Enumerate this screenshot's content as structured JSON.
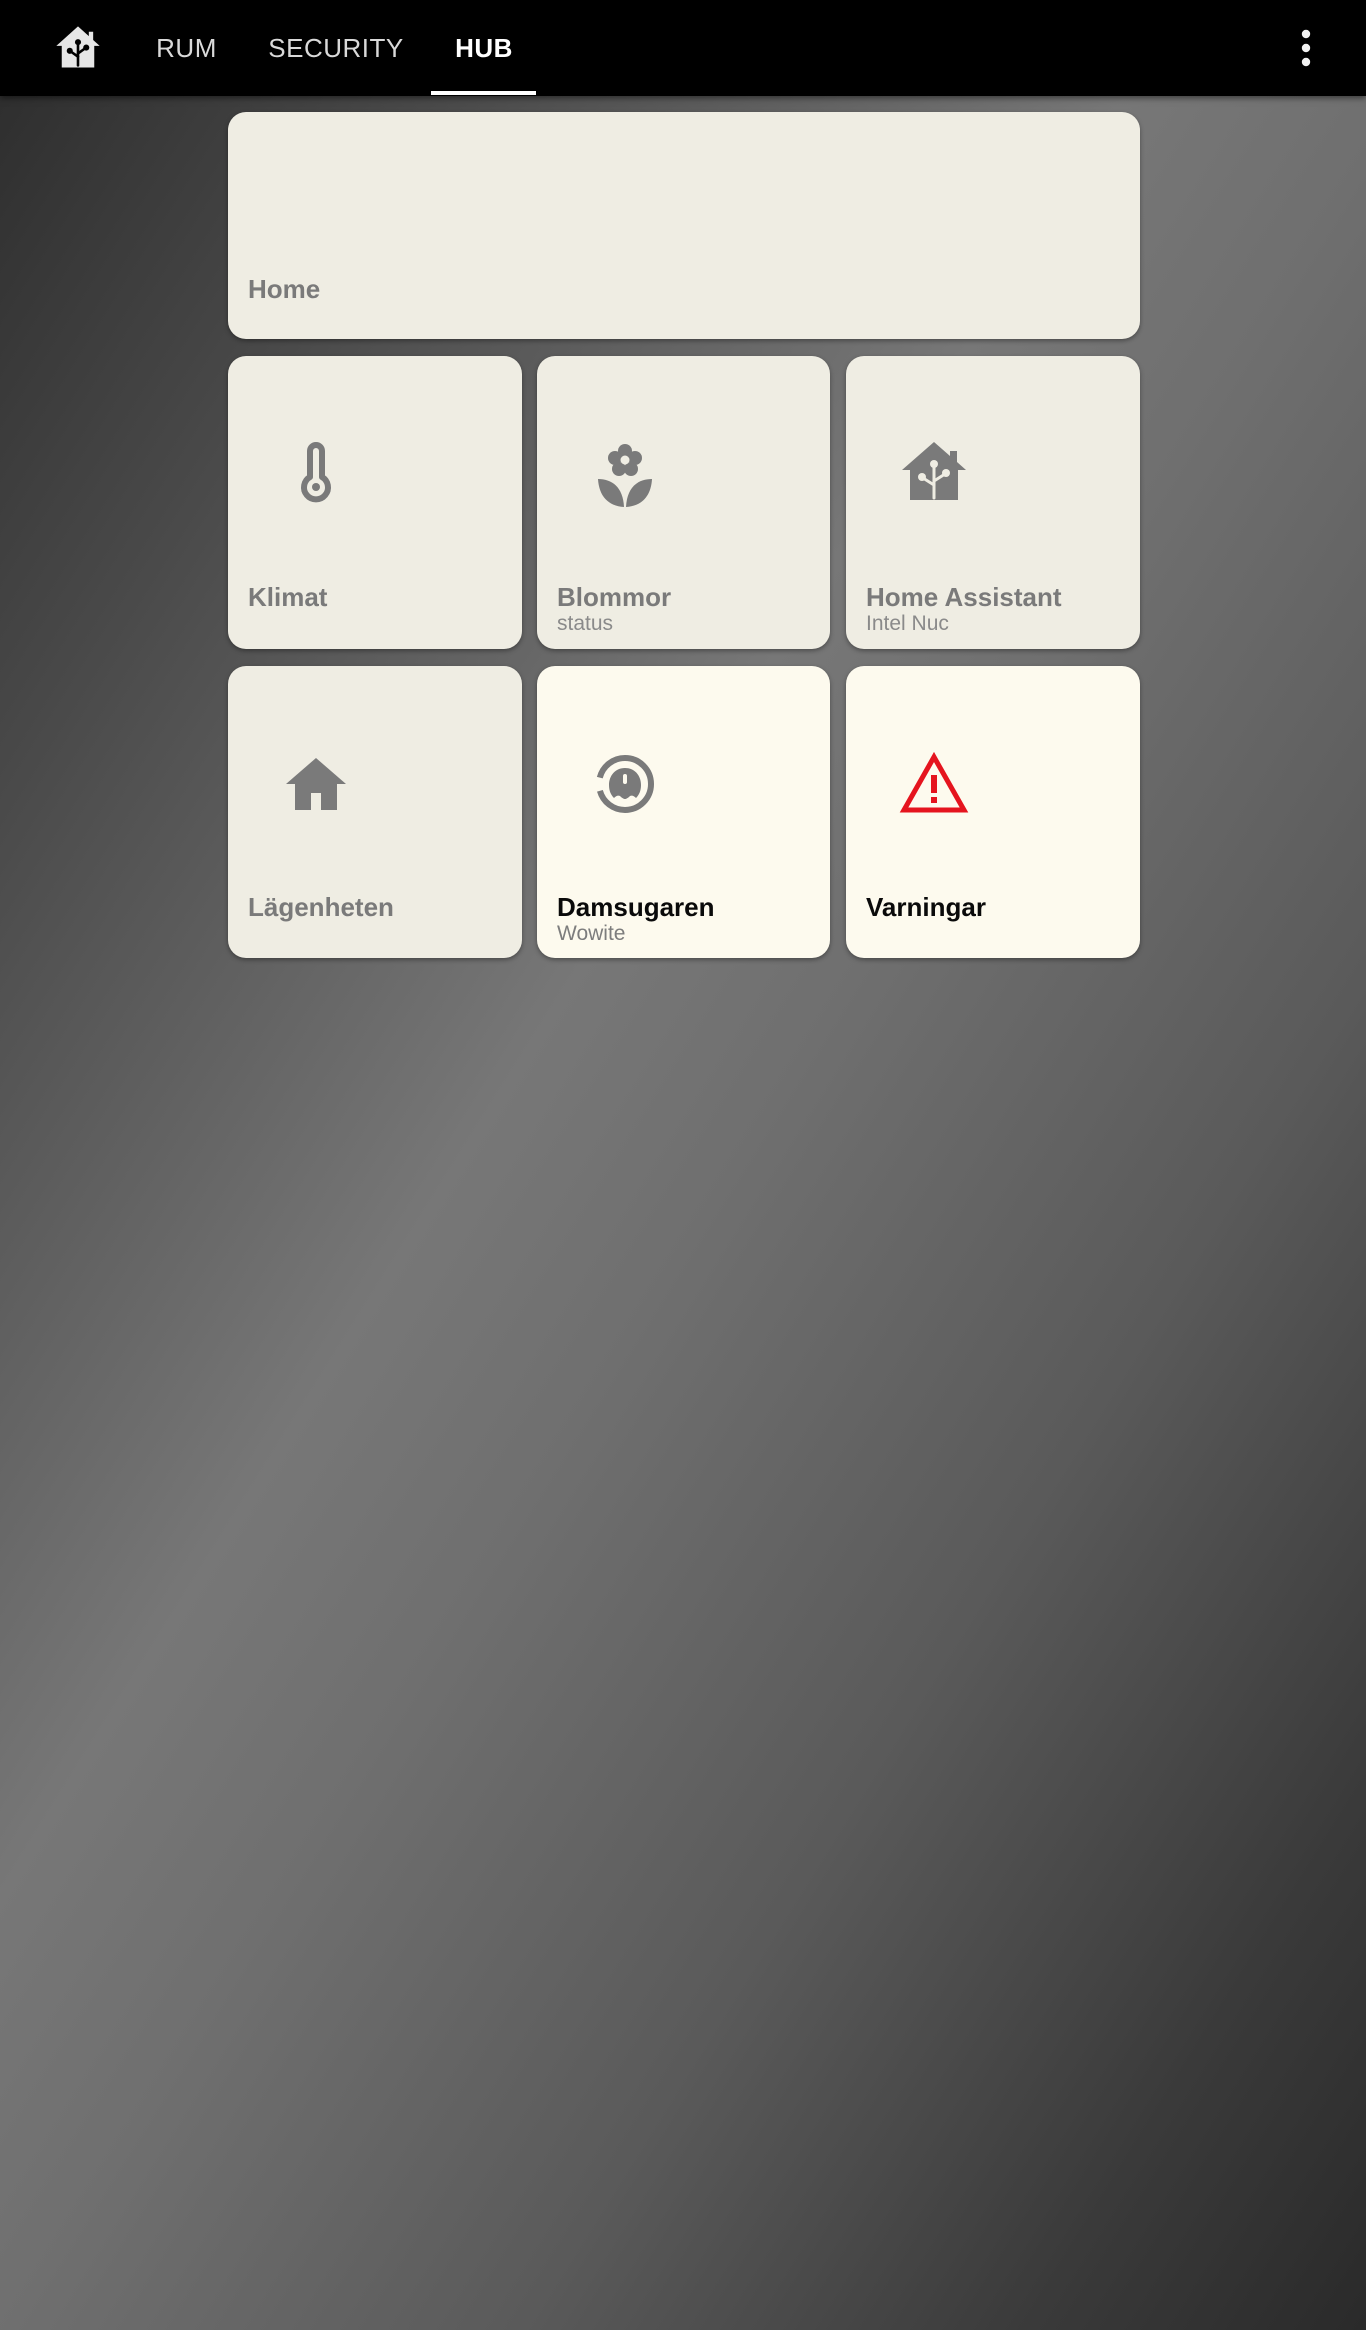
{
  "topbar": {
    "logo_icon": "home-assistant-icon",
    "tabs": [
      {
        "label": "RUM",
        "active": false
      },
      {
        "label": "SECURITY",
        "active": false
      },
      {
        "label": "HUB",
        "active": true
      }
    ],
    "menu_icon": "more-vertical-icon"
  },
  "cards": {
    "home": {
      "title": "Home"
    },
    "klimat": {
      "title": "Klimat",
      "icon": "thermometer-icon"
    },
    "blommor": {
      "title": "Blommor",
      "subtitle": "status",
      "icon": "flower-icon"
    },
    "home_assistant": {
      "title": "Home Assistant",
      "subtitle": "Intel Nuc",
      "icon": "home-assistant-icon"
    },
    "lagenheten": {
      "title": "Lägenheten",
      "icon": "house-icon"
    },
    "damsugaren": {
      "title": "Damsugaren",
      "subtitle": "Wowite",
      "icon": "robot-vacuum-icon",
      "state": "on"
    },
    "varningar": {
      "title": "Varningar",
      "icon": "alert-icon",
      "state": "on"
    }
  },
  "colors": {
    "topbar": "#000000",
    "card_off": "#efede3",
    "card_on": "#fdfaee",
    "icon_gray": "#7a7a7a",
    "alert_red": "#e5141e"
  }
}
